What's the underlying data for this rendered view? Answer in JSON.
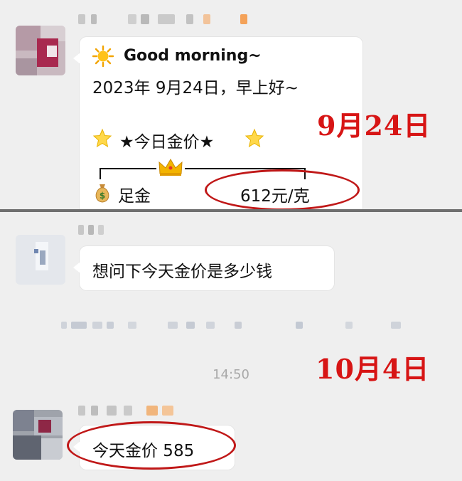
{
  "top_message": {
    "greeting": "Good morning~",
    "date_line": "2023年 9月24日，早上好~",
    "price_title": "★今日金价★",
    "item_label": "足金",
    "price": "612元/克"
  },
  "bottom_question": {
    "text": "想问下今天金价是多少钱"
  },
  "timestamp": "14:50",
  "bottom_reply": {
    "text": "今天金价 585"
  },
  "annotations": {
    "date_top": "9月24日",
    "date_bottom": "10月4日",
    "circle_color": "#c01818",
    "note_color": "#d71515"
  },
  "icons": {
    "sun": "sun-icon",
    "star": "star-icon",
    "crown": "crown-icon",
    "money_bag": "money-bag-icon"
  }
}
